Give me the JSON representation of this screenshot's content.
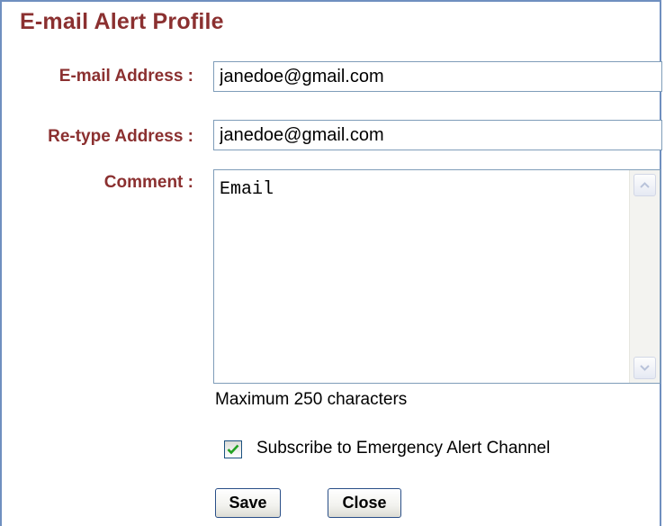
{
  "panel": {
    "title": "E-mail Alert Profile"
  },
  "form": {
    "email_label": "E-mail Address :",
    "email_value": "janedoe@gmail.com",
    "retype_label": "Re-type Address :",
    "retype_value": "janedoe@gmail.com",
    "comment_label": "Comment :",
    "comment_value": "Email",
    "comment_hint": "Maximum 250 characters",
    "subscribe_label": "Subscribe to Emergency Alert Channel",
    "subscribe_checked": true
  },
  "buttons": {
    "save_label": "Save",
    "close_label": "Close"
  },
  "colors": {
    "label": "#8b3030",
    "border": "#6f8fbf",
    "check": "#21a121"
  },
  "icons": {
    "scroll_up": "chevron-up-icon",
    "scroll_down": "chevron-down-icon",
    "checkmark": "checkmark-icon"
  }
}
